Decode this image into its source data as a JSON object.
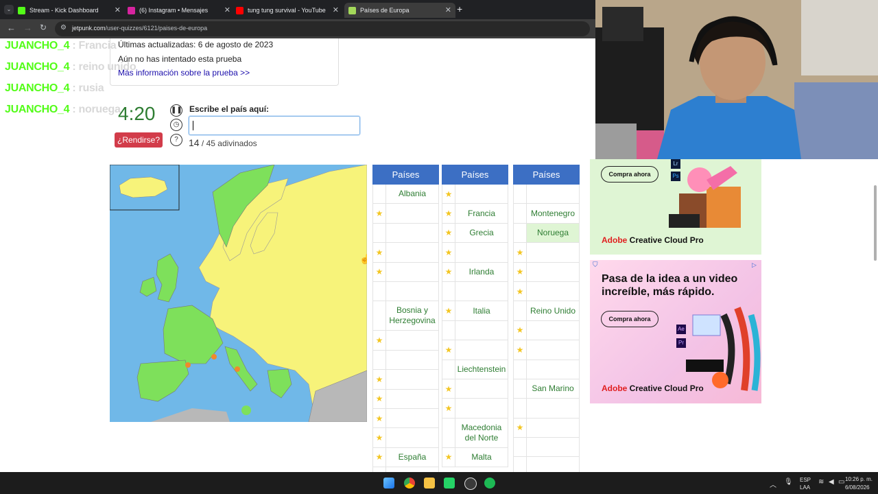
{
  "browser": {
    "tabs": [
      {
        "title": "Stream - Kick Dashboard",
        "icon": "kick-icon",
        "color": "#53fc18"
      },
      {
        "title": "(6) Instagram • Mensajes",
        "icon": "instagram-icon",
        "color": "#d6249f"
      },
      {
        "title": "tung tung survival - YouTube",
        "icon": "youtube-icon",
        "color": "#ff0000"
      },
      {
        "title": "Países de Europa",
        "icon": "jetpunk-icon",
        "color": "#a3d85a"
      }
    ],
    "new_tab": "+",
    "url_domain": "jetpunk.com",
    "url_path": "/user-quizzes/6121/paises-de-europa"
  },
  "quiz_info": {
    "updated": "Últimas actualizadas: 6 de agosto de 2023",
    "not_attempted": "Aún no has intentado esta prueba",
    "more_info": "Más información sobre la prueba >>"
  },
  "chat": [
    {
      "user": "JUANCHO_4",
      "sep": " : ",
      "msg": "Francia"
    },
    {
      "user": "JUANCHO_4",
      "sep": " : ",
      "msg": "reino unido"
    },
    {
      "user": "JUANCHO_4",
      "sep": " : ",
      "msg": "rusia"
    },
    {
      "user": "JUANCHO_4",
      "sep": " : ",
      "msg": "noruega"
    }
  ],
  "quiz": {
    "timer": "4:20",
    "prompt": "Escribe el país aquí:",
    "give_up": "¿Rendirse?",
    "guessed_count": "14",
    "guessed_suffix": "/ 45 adivinados",
    "help": "?"
  },
  "columns": [
    {
      "header": "Países",
      "rows": [
        {
          "star": false,
          "name": "Albania"
        },
        {
          "star": true,
          "name": ""
        },
        {
          "star": false,
          "name": ""
        },
        {
          "star": true,
          "name": ""
        },
        {
          "star": true,
          "name": ""
        },
        {
          "star": false,
          "name": ""
        },
        {
          "star": false,
          "name": "Bosnia y Herzegovina",
          "tall": true
        },
        {
          "star": true,
          "name": ""
        },
        {
          "star": false,
          "name": ""
        },
        {
          "star": true,
          "name": ""
        },
        {
          "star": true,
          "name": ""
        },
        {
          "star": true,
          "name": ""
        },
        {
          "star": true,
          "name": ""
        },
        {
          "star": true,
          "name": "España"
        },
        {
          "star": true,
          "name": ""
        }
      ]
    },
    {
      "header": "Países",
      "rows": [
        {
          "star": true,
          "name": ""
        },
        {
          "star": true,
          "name": "Francia"
        },
        {
          "star": true,
          "name": "Grecia"
        },
        {
          "star": true,
          "name": ""
        },
        {
          "star": true,
          "name": "Irlanda"
        },
        {
          "star": false,
          "name": ""
        },
        {
          "star": true,
          "name": "Italia"
        },
        {
          "star": false,
          "name": ""
        },
        {
          "star": true,
          "name": ""
        },
        {
          "star": false,
          "name": "Liechtenstein"
        },
        {
          "star": true,
          "name": ""
        },
        {
          "star": true,
          "name": ""
        },
        {
          "star": false,
          "name": "Macedonia del Norte",
          "tall": true
        },
        {
          "star": true,
          "name": "Malta"
        }
      ]
    },
    {
      "header": "Países",
      "rows": [
        {
          "star": false,
          "name": ""
        },
        {
          "star": false,
          "name": "Montenegro"
        },
        {
          "star": false,
          "name": "Noruega",
          "highlight": true
        },
        {
          "star": true,
          "name": ""
        },
        {
          "star": true,
          "name": ""
        },
        {
          "star": true,
          "name": ""
        },
        {
          "star": false,
          "name": "Reino Unido"
        },
        {
          "star": true,
          "name": ""
        },
        {
          "star": true,
          "name": ""
        },
        {
          "star": false,
          "name": ""
        },
        {
          "star": false,
          "name": "San Marino"
        },
        {
          "star": false,
          "name": ""
        },
        {
          "star": true,
          "name": ""
        },
        {
          "star": false,
          "name": ""
        },
        {
          "star": false,
          "name": ""
        }
      ]
    }
  ],
  "ads": [
    {
      "headline": "",
      "cta": "Compra ahora",
      "brand_a": "Adobe ",
      "brand_b": "Creative Cloud Pro",
      "apps": [
        "Lr",
        "Ps"
      ]
    },
    {
      "headline": "Pasa de la idea a un video increíble, más rápido.",
      "cta": "Compra ahora",
      "brand_a": "Adobe ",
      "brand_b": "Creative Cloud Pro",
      "apps": [
        "Ae",
        "Pr"
      ]
    }
  ],
  "taskbar": {
    "lang": "ESP",
    "lang_sub": "LAA",
    "time": "10:26 p. m.",
    "date": "6/08/2026"
  },
  "star_glyph": "★"
}
